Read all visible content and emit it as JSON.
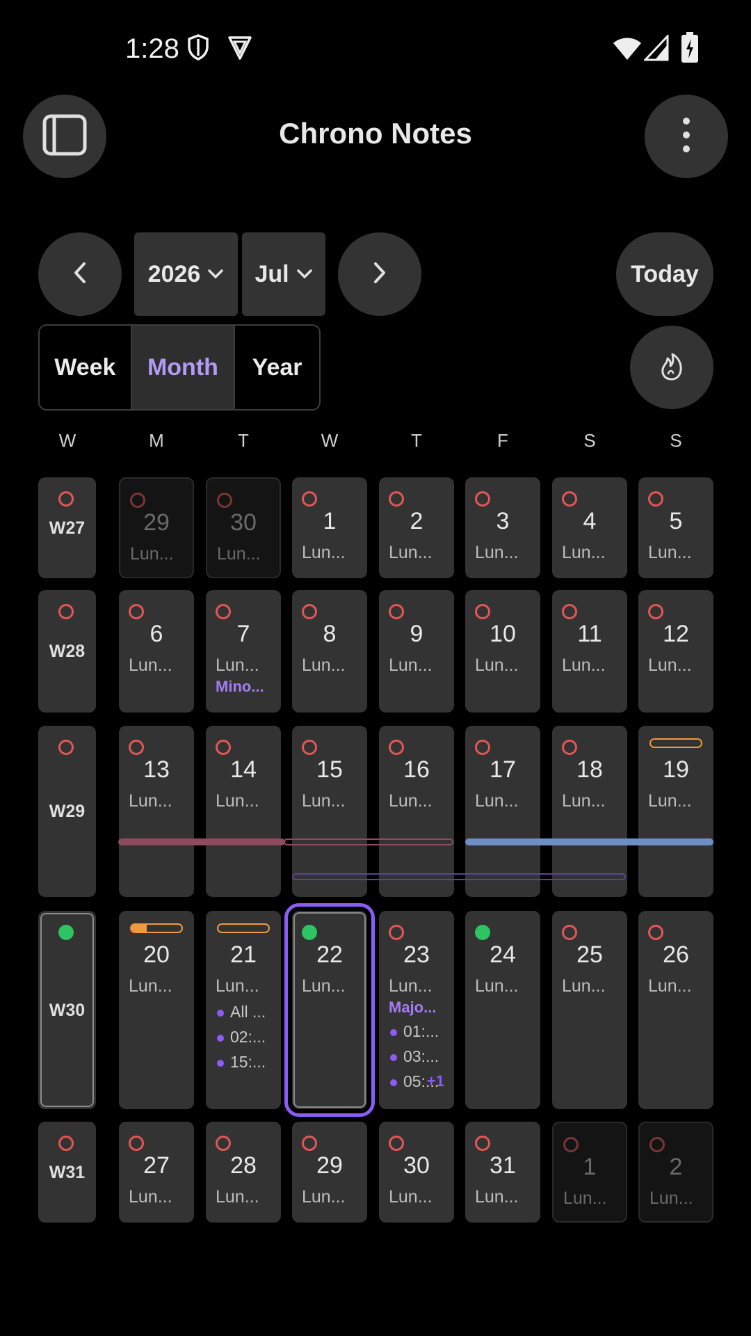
{
  "status_bar": {
    "time": "1:28",
    "icons": [
      "shield-icon",
      "vpn-icon",
      "wifi-icon",
      "signal-icon",
      "battery-charging-icon"
    ]
  },
  "app_bar": {
    "title": "Chrono Notes",
    "left_icon": "sidebar-panel-icon",
    "right_icon": "more-vertical-icon"
  },
  "nav": {
    "prev_icon": "chevron-left-icon",
    "next_icon": "chevron-right-icon",
    "year": "2026",
    "month": "Jul",
    "today_label": "Today",
    "streak_icon": "flame-icon"
  },
  "view_modes": {
    "week": "Week",
    "month": "Month",
    "year": "Year",
    "active": "Month"
  },
  "weekday_header": {
    "week": "W",
    "days": [
      "M",
      "T",
      "W",
      "T",
      "F",
      "S",
      "S"
    ]
  },
  "weeks": [
    {
      "label": "W27",
      "days": [
        {
          "num": "29",
          "lunar": "Lun...",
          "other": true
        },
        {
          "num": "30",
          "lunar": "Lun...",
          "other": true
        },
        {
          "num": "1",
          "lunar": "Lun..."
        },
        {
          "num": "2",
          "lunar": "Lun..."
        },
        {
          "num": "3",
          "lunar": "Lun..."
        },
        {
          "num": "4",
          "lunar": "Lun..."
        },
        {
          "num": "5",
          "lunar": "Lun..."
        }
      ]
    },
    {
      "label": "W28",
      "days": [
        {
          "num": "6",
          "lunar": "Lun..."
        },
        {
          "num": "7",
          "lunar": "Lun...",
          "tag": "Mino..."
        },
        {
          "num": "8",
          "lunar": "Lun..."
        },
        {
          "num": "9",
          "lunar": "Lun..."
        },
        {
          "num": "10",
          "lunar": "Lun..."
        },
        {
          "num": "11",
          "lunar": "Lun..."
        },
        {
          "num": "12",
          "lunar": "Lun..."
        }
      ]
    },
    {
      "label": "W29",
      "days": [
        {
          "num": "13",
          "lunar": "Lun..."
        },
        {
          "num": "14",
          "lunar": "Lun..."
        },
        {
          "num": "15",
          "lunar": "Lun..."
        },
        {
          "num": "16",
          "lunar": "Lun..."
        },
        {
          "num": "17",
          "lunar": "Lun..."
        },
        {
          "num": "18",
          "lunar": "Lun..."
        },
        {
          "num": "19",
          "lunar": "Lun...",
          "pill_progress": 0
        }
      ]
    },
    {
      "label": "W30",
      "current": true,
      "days": [
        {
          "num": "20",
          "lunar": "Lun...",
          "pill_progress": 0.3
        },
        {
          "num": "21",
          "lunar": "Lun...",
          "pill_progress": 0,
          "events": [
            "All ...",
            "02:...",
            "15:..."
          ]
        },
        {
          "num": "22",
          "lunar": "Lun...",
          "selected": true,
          "done": true
        },
        {
          "num": "23",
          "lunar": "Lun...",
          "tag": "Majo...",
          "events": [
            "01:...",
            "03:...",
            "05:..."
          ],
          "more": "+1"
        },
        {
          "num": "24",
          "lunar": "Lun...",
          "done": true
        },
        {
          "num": "25",
          "lunar": "Lun..."
        },
        {
          "num": "26",
          "lunar": "Lun..."
        }
      ]
    },
    {
      "label": "W31",
      "days": [
        {
          "num": "27",
          "lunar": "Lun..."
        },
        {
          "num": "28",
          "lunar": "Lun..."
        },
        {
          "num": "29",
          "lunar": "Lun..."
        },
        {
          "num": "30",
          "lunar": "Lun..."
        },
        {
          "num": "31",
          "lunar": "Lun..."
        },
        {
          "num": "1",
          "lunar": "Lun...",
          "other": true
        },
        {
          "num": "2",
          "lunar": "Lun...",
          "other": true
        }
      ]
    }
  ],
  "colors": {
    "accent": "#8b5cf6",
    "incomplete_ring": "#e45656",
    "complete_dot": "#2fc463",
    "pill": "#f09a3e",
    "span_rose": "#8e4a5e",
    "span_blue": "#6d8fc4",
    "span_purple_outline": "#5a4690"
  }
}
